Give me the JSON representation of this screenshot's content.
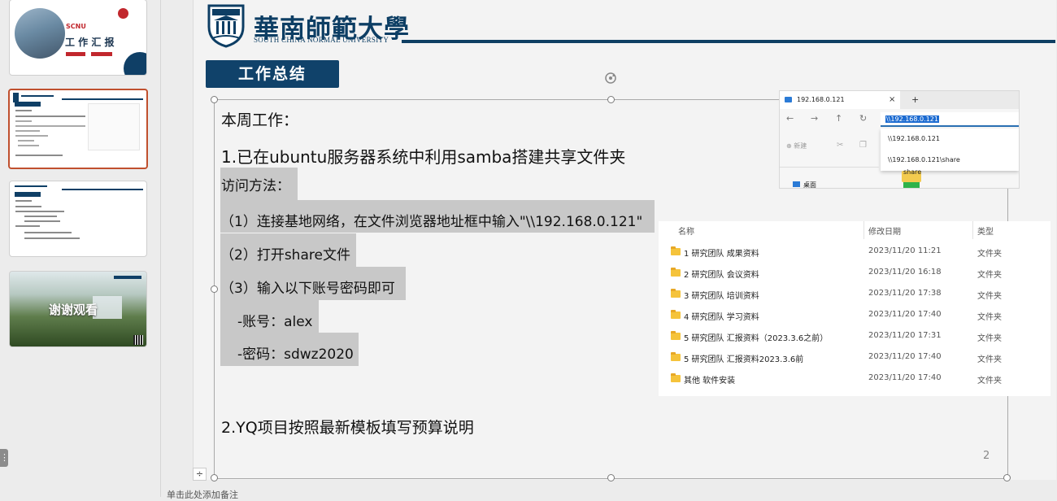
{
  "thumbnails": {
    "slide1": {
      "brand": "SCNU",
      "title": "工 作 汇 报"
    },
    "slide4": {
      "title": "谢谢观看"
    }
  },
  "slide": {
    "logo_text": "華南師範大學",
    "logo_sub": "SOUTH CHINA NORMAL UNIVERSITY",
    "section_title": "工作总结",
    "lines": {
      "weekly": "本周工作：",
      "item1": "1.已在ubuntu服务器系统中利用samba搭建共享文件夹",
      "access": "访问方法：",
      "step1": "（1）连接基地网络，在文件浏览器地址框中输入\"\\\\192.168.0.121\"",
      "step2": "（2）打开share文件",
      "step3": "（3）输入以下账号密码即可",
      "account": "-账号：alex",
      "password": "-密码：sdwz2020",
      "item2": "2.YQ项目按照最新模板填写预算说明"
    },
    "page_number": "2"
  },
  "explorer_shot": {
    "tab_title": "192.168.0.121",
    "tab_close": "×",
    "tab_new": "+",
    "address_value": "\\\\192.168.0.121",
    "suggestions": [
      "\\\\192.168.0.121",
      "\\\\192.168.0.121\\share"
    ],
    "new_button": "新建",
    "folder_label": "share",
    "desktop_label": "桌面"
  },
  "file_list": {
    "headers": {
      "name": "名称",
      "date": "修改日期",
      "type": "类型"
    },
    "rows": [
      {
        "name": "1 研究团队 成果资料",
        "date": "2023/11/20 11:21",
        "type": "文件夹"
      },
      {
        "name": "2 研究团队 会议资料",
        "date": "2023/11/20 16:18",
        "type": "文件夹"
      },
      {
        "name": "3 研究团队 培训资料",
        "date": "2023/11/20 17:38",
        "type": "文件夹"
      },
      {
        "name": "4 研究团队 学习资料",
        "date": "2023/11/20 17:40",
        "type": "文件夹"
      },
      {
        "name": "5 研究团队 汇报资料（2023.3.6之前）",
        "date": "2023/11/20 17:31",
        "type": "文件夹"
      },
      {
        "name": "5 研究团队 汇报资料2023.3.6前",
        "date": "2023/11/20 17:40",
        "type": "文件夹"
      },
      {
        "name": "其他  软件安装",
        "date": "2023/11/20 17:40",
        "type": "文件夹"
      }
    ]
  },
  "notes_placeholder": "单击此处添加备注",
  "colors": {
    "navy": "#10426a",
    "highlight": "#c8c8c8",
    "selected_thumb": "#c0502e"
  }
}
